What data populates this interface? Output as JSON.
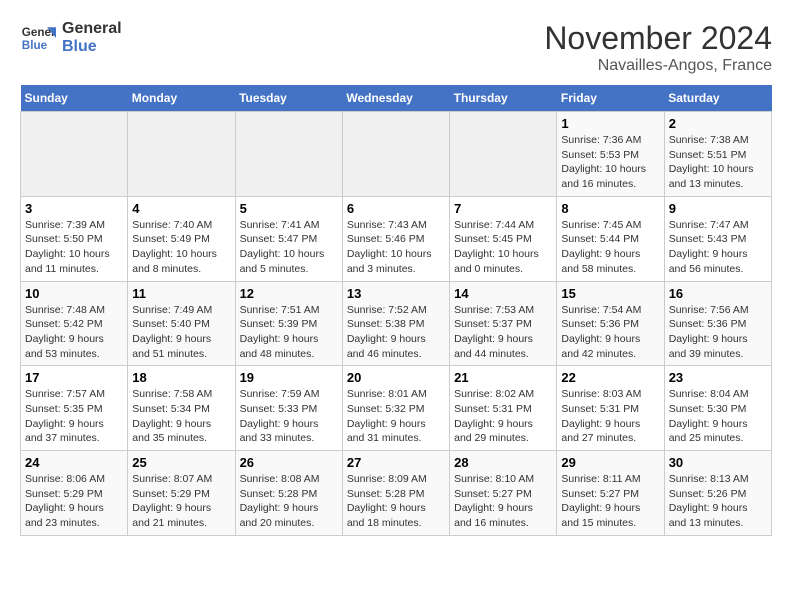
{
  "header": {
    "logo_line1": "General",
    "logo_line2": "Blue",
    "month": "November 2024",
    "location": "Navailles-Angos, France"
  },
  "weekdays": [
    "Sunday",
    "Monday",
    "Tuesday",
    "Wednesday",
    "Thursday",
    "Friday",
    "Saturday"
  ],
  "weeks": [
    [
      {
        "day": "",
        "info": ""
      },
      {
        "day": "",
        "info": ""
      },
      {
        "day": "",
        "info": ""
      },
      {
        "day": "",
        "info": ""
      },
      {
        "day": "",
        "info": ""
      },
      {
        "day": "1",
        "info": "Sunrise: 7:36 AM\nSunset: 5:53 PM\nDaylight: 10 hours and 16 minutes."
      },
      {
        "day": "2",
        "info": "Sunrise: 7:38 AM\nSunset: 5:51 PM\nDaylight: 10 hours and 13 minutes."
      }
    ],
    [
      {
        "day": "3",
        "info": "Sunrise: 7:39 AM\nSunset: 5:50 PM\nDaylight: 10 hours and 11 minutes."
      },
      {
        "day": "4",
        "info": "Sunrise: 7:40 AM\nSunset: 5:49 PM\nDaylight: 10 hours and 8 minutes."
      },
      {
        "day": "5",
        "info": "Sunrise: 7:41 AM\nSunset: 5:47 PM\nDaylight: 10 hours and 5 minutes."
      },
      {
        "day": "6",
        "info": "Sunrise: 7:43 AM\nSunset: 5:46 PM\nDaylight: 10 hours and 3 minutes."
      },
      {
        "day": "7",
        "info": "Sunrise: 7:44 AM\nSunset: 5:45 PM\nDaylight: 10 hours and 0 minutes."
      },
      {
        "day": "8",
        "info": "Sunrise: 7:45 AM\nSunset: 5:44 PM\nDaylight: 9 hours and 58 minutes."
      },
      {
        "day": "9",
        "info": "Sunrise: 7:47 AM\nSunset: 5:43 PM\nDaylight: 9 hours and 56 minutes."
      }
    ],
    [
      {
        "day": "10",
        "info": "Sunrise: 7:48 AM\nSunset: 5:42 PM\nDaylight: 9 hours and 53 minutes."
      },
      {
        "day": "11",
        "info": "Sunrise: 7:49 AM\nSunset: 5:40 PM\nDaylight: 9 hours and 51 minutes."
      },
      {
        "day": "12",
        "info": "Sunrise: 7:51 AM\nSunset: 5:39 PM\nDaylight: 9 hours and 48 minutes."
      },
      {
        "day": "13",
        "info": "Sunrise: 7:52 AM\nSunset: 5:38 PM\nDaylight: 9 hours and 46 minutes."
      },
      {
        "day": "14",
        "info": "Sunrise: 7:53 AM\nSunset: 5:37 PM\nDaylight: 9 hours and 44 minutes."
      },
      {
        "day": "15",
        "info": "Sunrise: 7:54 AM\nSunset: 5:36 PM\nDaylight: 9 hours and 42 minutes."
      },
      {
        "day": "16",
        "info": "Sunrise: 7:56 AM\nSunset: 5:36 PM\nDaylight: 9 hours and 39 minutes."
      }
    ],
    [
      {
        "day": "17",
        "info": "Sunrise: 7:57 AM\nSunset: 5:35 PM\nDaylight: 9 hours and 37 minutes."
      },
      {
        "day": "18",
        "info": "Sunrise: 7:58 AM\nSunset: 5:34 PM\nDaylight: 9 hours and 35 minutes."
      },
      {
        "day": "19",
        "info": "Sunrise: 7:59 AM\nSunset: 5:33 PM\nDaylight: 9 hours and 33 minutes."
      },
      {
        "day": "20",
        "info": "Sunrise: 8:01 AM\nSunset: 5:32 PM\nDaylight: 9 hours and 31 minutes."
      },
      {
        "day": "21",
        "info": "Sunrise: 8:02 AM\nSunset: 5:31 PM\nDaylight: 9 hours and 29 minutes."
      },
      {
        "day": "22",
        "info": "Sunrise: 8:03 AM\nSunset: 5:31 PM\nDaylight: 9 hours and 27 minutes."
      },
      {
        "day": "23",
        "info": "Sunrise: 8:04 AM\nSunset: 5:30 PM\nDaylight: 9 hours and 25 minutes."
      }
    ],
    [
      {
        "day": "24",
        "info": "Sunrise: 8:06 AM\nSunset: 5:29 PM\nDaylight: 9 hours and 23 minutes."
      },
      {
        "day": "25",
        "info": "Sunrise: 8:07 AM\nSunset: 5:29 PM\nDaylight: 9 hours and 21 minutes."
      },
      {
        "day": "26",
        "info": "Sunrise: 8:08 AM\nSunset: 5:28 PM\nDaylight: 9 hours and 20 minutes."
      },
      {
        "day": "27",
        "info": "Sunrise: 8:09 AM\nSunset: 5:28 PM\nDaylight: 9 hours and 18 minutes."
      },
      {
        "day": "28",
        "info": "Sunrise: 8:10 AM\nSunset: 5:27 PM\nDaylight: 9 hours and 16 minutes."
      },
      {
        "day": "29",
        "info": "Sunrise: 8:11 AM\nSunset: 5:27 PM\nDaylight: 9 hours and 15 minutes."
      },
      {
        "day": "30",
        "info": "Sunrise: 8:13 AM\nSunset: 5:26 PM\nDaylight: 9 hours and 13 minutes."
      }
    ]
  ]
}
